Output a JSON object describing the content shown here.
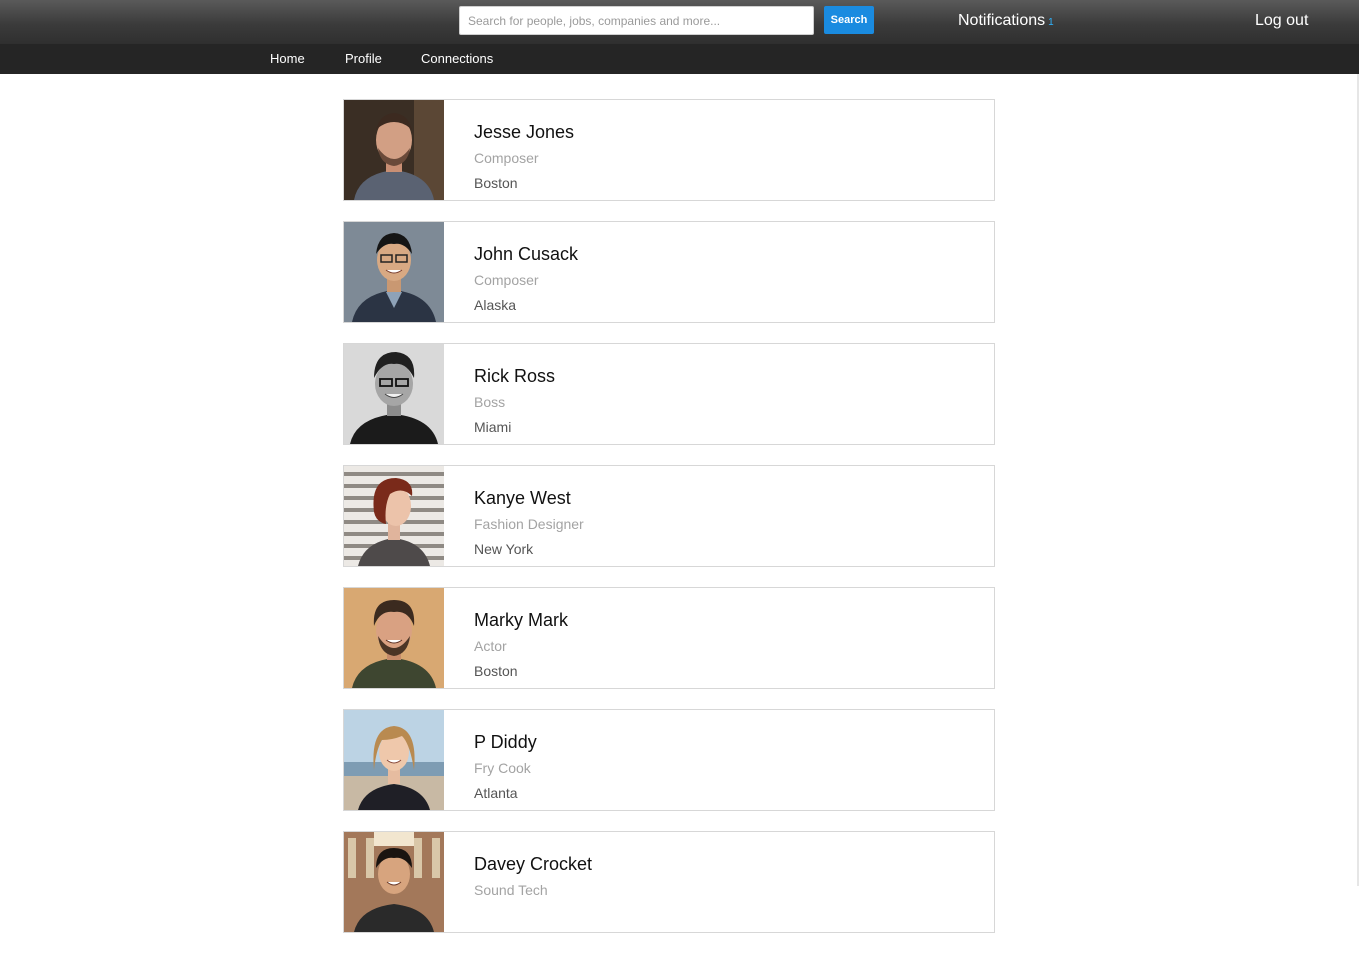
{
  "header": {
    "search_placeholder": "Search for people, jobs, companies and more...",
    "search_button": "Search",
    "notifications_label": "Notifications",
    "notifications_count": "1",
    "logout_label": "Log out"
  },
  "nav": {
    "items": [
      {
        "label": "Home"
      },
      {
        "label": "Profile"
      },
      {
        "label": "Connections"
      }
    ]
  },
  "people": [
    {
      "name": "Jesse Jones",
      "title": "Composer",
      "location": "Boston"
    },
    {
      "name": "John Cusack",
      "title": "Composer",
      "location": "Alaska"
    },
    {
      "name": "Rick Ross",
      "title": "Boss",
      "location": "Miami"
    },
    {
      "name": "Kanye West",
      "title": "Fashion Designer",
      "location": "New York"
    },
    {
      "name": "Marky Mark",
      "title": "Actor",
      "location": "Boston"
    },
    {
      "name": "P Diddy",
      "title": "Fry Cook",
      "location": "Atlanta"
    },
    {
      "name": "Davey Crocket",
      "title": "Sound Tech",
      "location": ""
    }
  ],
  "colors": {
    "accent": "#1a8be0",
    "notification_count": "#2fb4ff",
    "topbar": "#3b3b3b",
    "navbar": "#252525"
  }
}
